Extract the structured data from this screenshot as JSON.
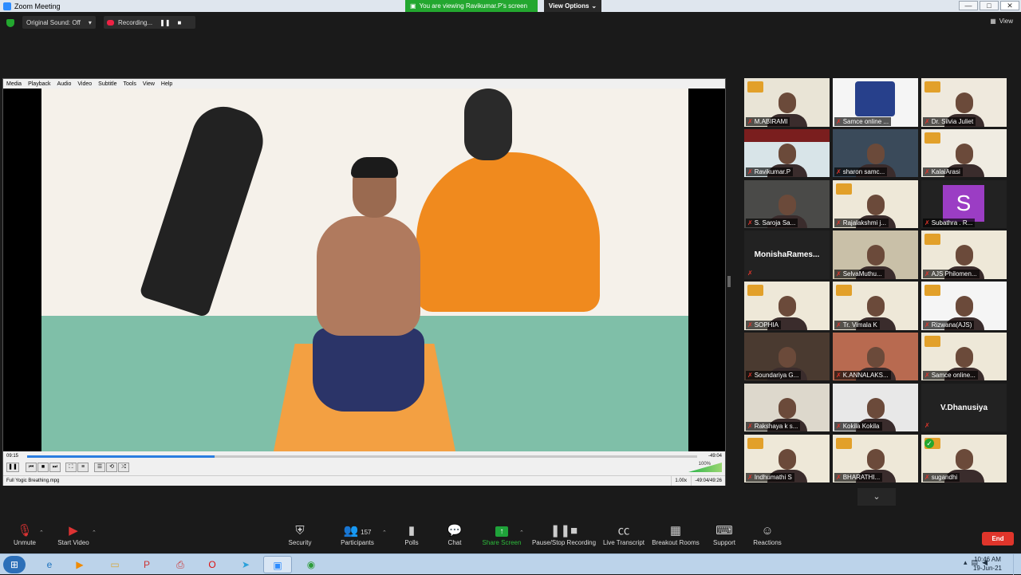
{
  "window": {
    "title": "Zoom Meeting",
    "viewing_banner": "You are viewing Ravikumar.P's screen",
    "view_options": "View Options",
    "controls": [
      "—",
      "□",
      "✕"
    ]
  },
  "topbar": {
    "original_sound": "Original Sound: Off",
    "recording": "Recording...",
    "view_label": "View"
  },
  "vlc": {
    "menu": [
      "Media",
      "Playback",
      "Audio",
      "Video",
      "Subtitle",
      "Tools",
      "View",
      "Help"
    ],
    "time_elapsed": "09:15",
    "time_remaining": "-49:04",
    "progress": 0.28,
    "volume": "100%",
    "filename": "Full Yogic Breathing.mpg",
    "speed": "1.00x",
    "duration": "-49:04/49:26"
  },
  "gallery": [
    {
      "name": "M.ABIRAMI",
      "type": "video",
      "bg": "#e9e4d6",
      "logo": true
    },
    {
      "name": "Samce online ...",
      "type": "video",
      "bg": "#f5f5f5",
      "emblem": true
    },
    {
      "name": "Dr. Silvia Juliet",
      "type": "video",
      "bg": "#efe9dd",
      "logo": true
    },
    {
      "name": "Ravikumar.P",
      "type": "video",
      "bg": "#d8e4e8",
      "active": true,
      "banner": "#7a1e1e"
    },
    {
      "name": "sharon samc...",
      "type": "video",
      "bg": "#3a4a5a"
    },
    {
      "name": "KalaiArasi",
      "type": "video",
      "bg": "#f0ece2",
      "logo": true
    },
    {
      "name": "S. Saroja Sa...",
      "type": "video",
      "bg": "#4a4a48"
    },
    {
      "name": "Rajalakshmi j...",
      "type": "video",
      "bg": "#eee8d8",
      "logo": true
    },
    {
      "name": "Subathra . R...",
      "type": "avatar",
      "letter": "S"
    },
    {
      "name": "MonishaRames...",
      "type": "nameonly",
      "display": "MonishaRames..."
    },
    {
      "name": "SelvaMuthu...",
      "type": "video",
      "bg": "#c9c0a8"
    },
    {
      "name": "AJS Philomen...",
      "type": "video",
      "bg": "#eee8d8",
      "logo": true
    },
    {
      "name": "SOPHIA",
      "type": "video",
      "bg": "#eee8d8",
      "logo": true
    },
    {
      "name": "Tr. Vimala K",
      "type": "video",
      "bg": "#eee8d8",
      "logo": true
    },
    {
      "name": "Rizwana(AJS)",
      "type": "video",
      "bg": "#f5f5f5",
      "logo": true
    },
    {
      "name": "Soundariya G...",
      "type": "video",
      "bg": "#4a3a30"
    },
    {
      "name": "K.ANNALAKS...",
      "type": "video",
      "bg": "#b86a50"
    },
    {
      "name": "Samce online...",
      "type": "video",
      "bg": "#eee8d8",
      "logo": true
    },
    {
      "name": "Rakshaya k s...",
      "type": "video",
      "bg": "#ddd8cc"
    },
    {
      "name": "Kokila Kokila",
      "type": "video",
      "bg": "#e8e8e8"
    },
    {
      "name": "V.Dhanusiya",
      "type": "nameonly",
      "display": "V.Dhanusiya"
    },
    {
      "name": "Indhumathi S",
      "type": "video",
      "bg": "#eee8d8",
      "logo": true
    },
    {
      "name": "BHARATHI...",
      "type": "video",
      "bg": "#eee8d8",
      "logo": true
    },
    {
      "name": "sugandhi",
      "type": "video",
      "bg": "#eee8d8",
      "logo": true,
      "check": true
    }
  ],
  "controls": {
    "unmute": "Unmute",
    "start_video": "Start Video",
    "security": "Security",
    "participants": "Participants",
    "participant_count": "157",
    "polls": "Polls",
    "chat": "Chat",
    "share_screen": "Share Screen",
    "pause_stop_recording": "Pause/Stop Recording",
    "live_transcript": "Live Transcript",
    "breakout_rooms": "Breakout Rooms",
    "support": "Support",
    "reactions": "Reactions",
    "end": "End"
  },
  "taskbar": {
    "time": "10:46 AM",
    "date": "19-Jun-21"
  }
}
